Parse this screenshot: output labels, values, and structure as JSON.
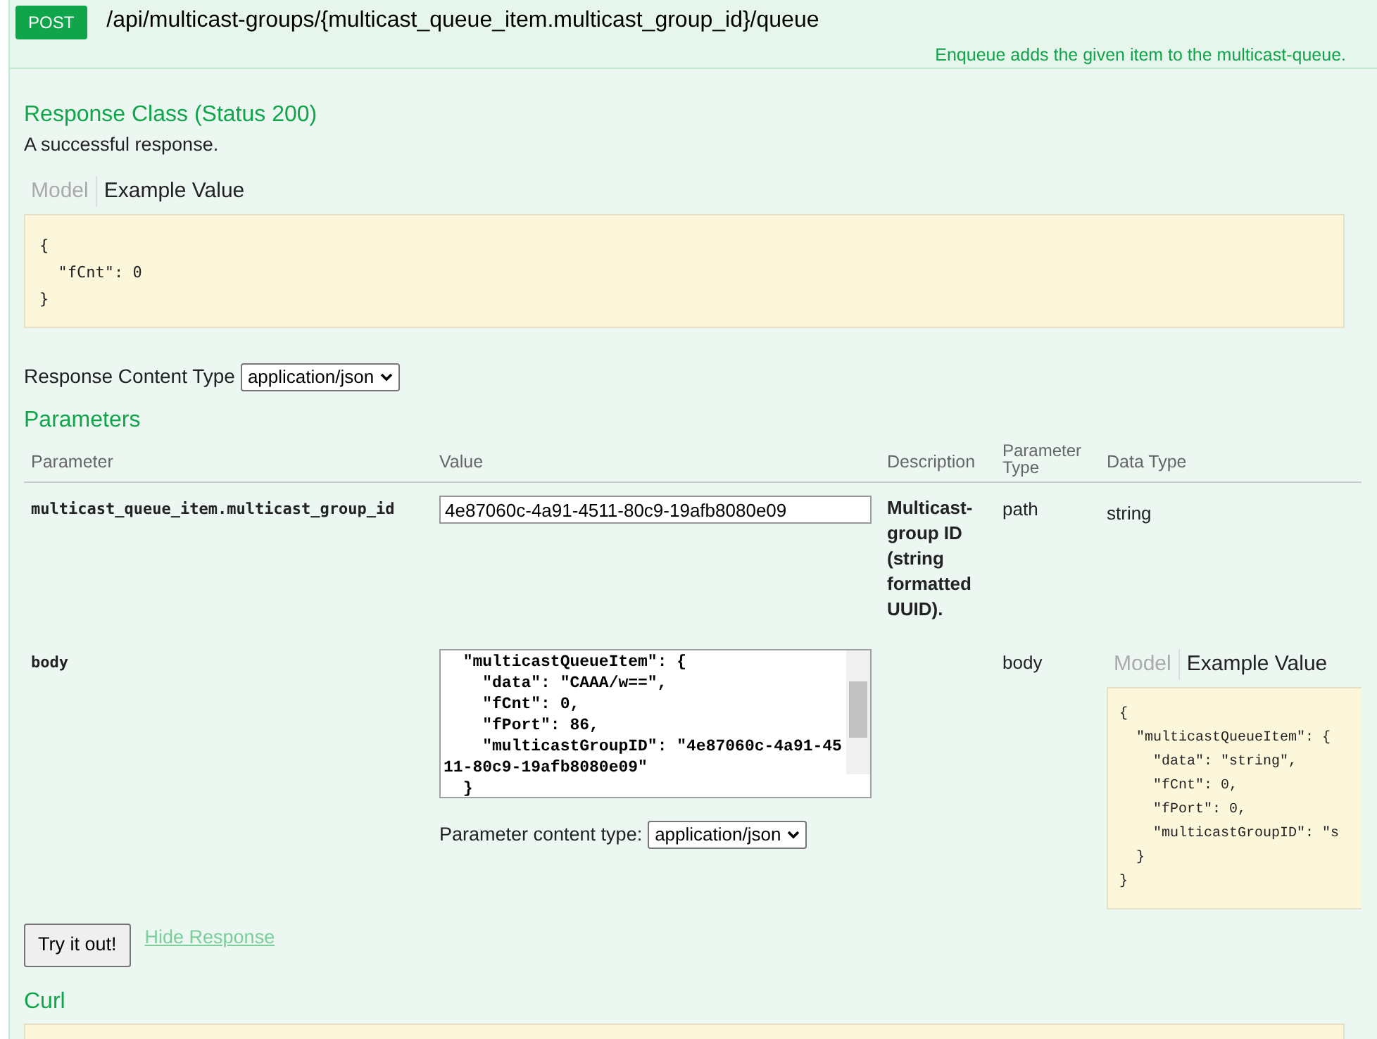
{
  "endpoint": {
    "method": "POST",
    "path": "/api/multicast-groups/{multicast_queue_item.multicast_group_id}/queue",
    "summary": "Enqueue adds the given item to the multicast-queue."
  },
  "response_class": {
    "title": "Response Class (Status 200)",
    "description": "A successful response.",
    "tabs": [
      {
        "label": "Model",
        "selected": false
      },
      {
        "label": "Example Value",
        "selected": true
      }
    ],
    "example": [
      "{",
      "  \"fCnt\": 0",
      "}"
    ]
  },
  "response_content_type": {
    "label": "Response Content Type",
    "value": "application/json"
  },
  "parameters": {
    "title": "Parameters",
    "columns": [
      "Parameter",
      "Value",
      "Description",
      "Parameter Type",
      "Data Type"
    ],
    "rows": [
      {
        "kind": "input",
        "name": "multicast_queue_item.multicast_group_id",
        "value": "4e87060c-4a91-4511-80c9-19afb8080e09",
        "description": "Multicast-group ID (string formatted UUID).",
        "param_type": "path",
        "data_type": "string"
      },
      {
        "kind": "body",
        "name": "body",
        "value_lines": [
          "  \"multicastQueueItem\": {",
          "    \"data\": \"CAAA/w==\",",
          "    \"fCnt\": 0,",
          "    \"fPort\": 86,",
          "    \"multicastGroupID\": \"4e87060c-4a91-4511-80c9-19afb8080e09\"",
          "  }"
        ],
        "content_type_label": "Parameter content type:",
        "content_type": "application/json",
        "param_type": "body",
        "tabs": [
          {
            "label": "Model",
            "selected": false
          },
          {
            "label": "Example Value",
            "selected": true
          }
        ],
        "example": [
          "{",
          "  \"multicastQueueItem\": {",
          "    \"data\": \"string\",",
          "    \"fCnt\": 0,",
          "    \"fPort\": 0,",
          "    \"multicastGroupID\": \"s",
          "  }",
          "}"
        ]
      }
    ]
  },
  "actions": {
    "button": "Try it out!",
    "link": "Hide Response"
  },
  "curl": {
    "title": "Curl"
  }
}
